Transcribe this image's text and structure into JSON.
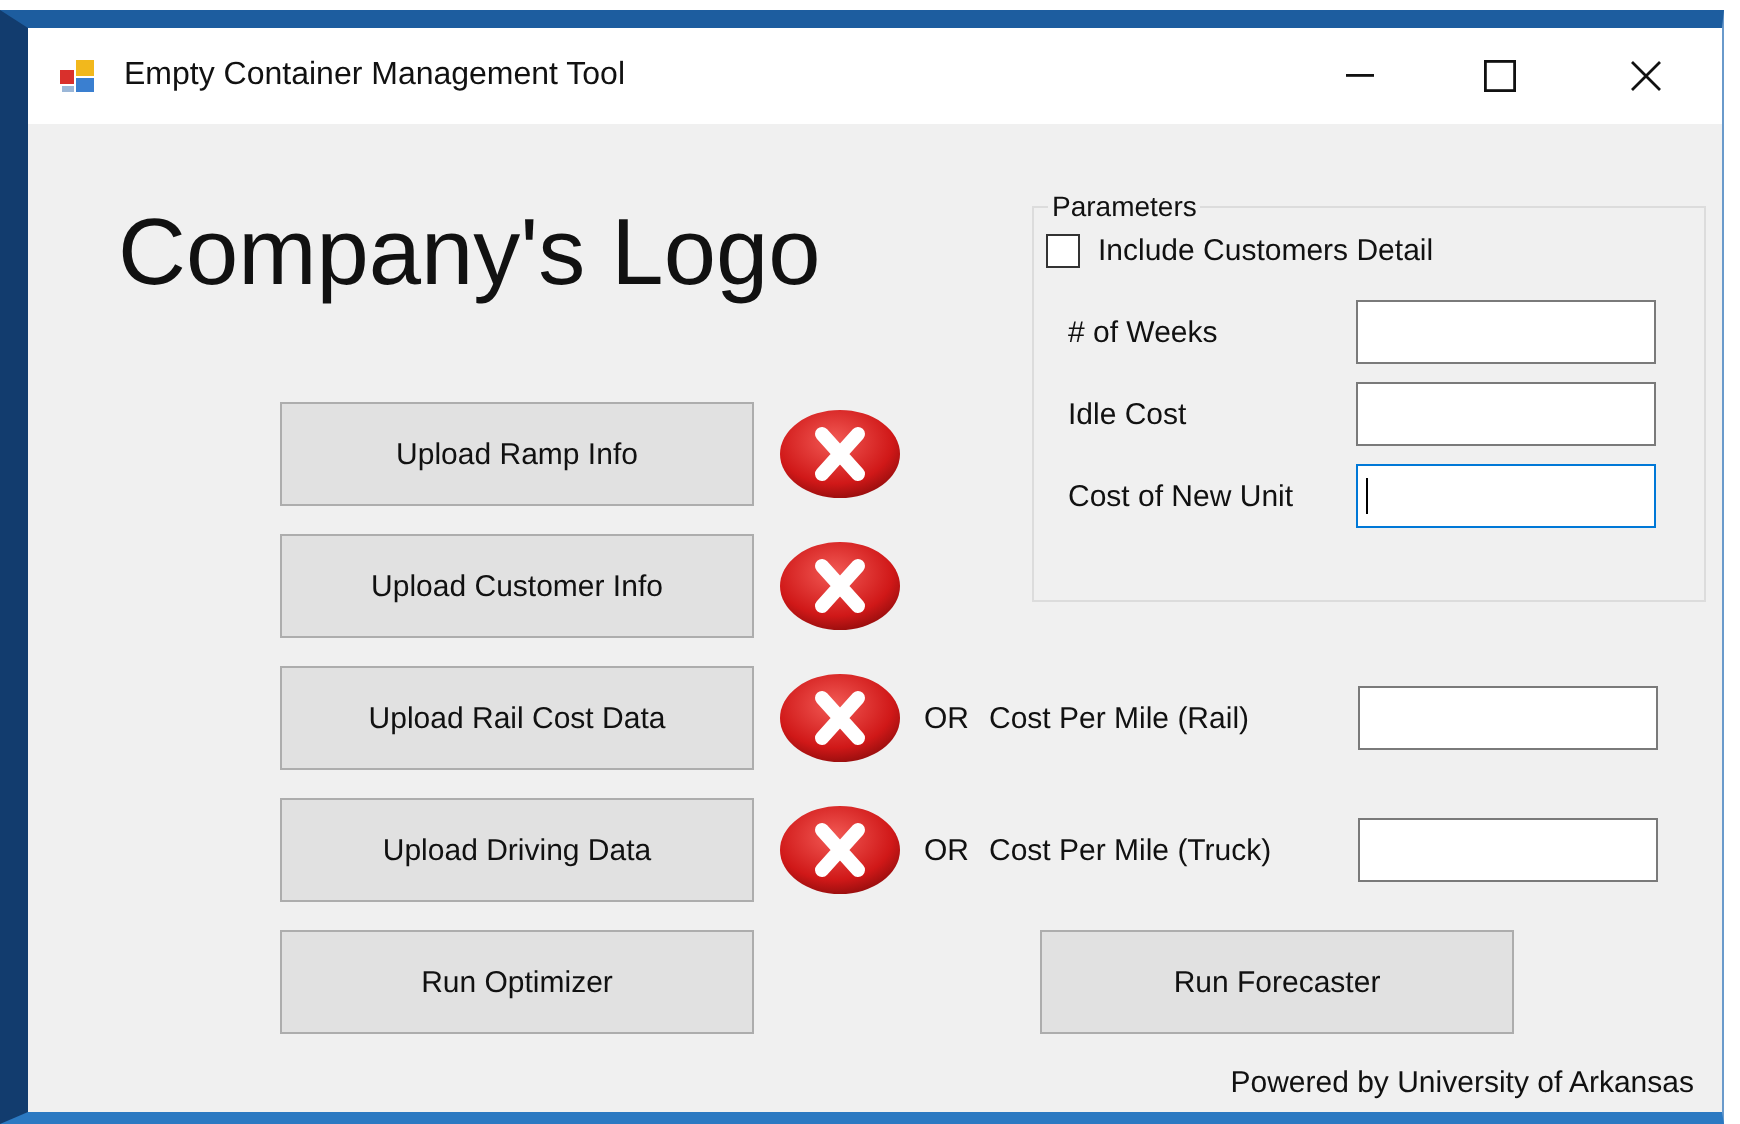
{
  "window": {
    "title": "Empty Container Management Tool"
  },
  "logo_text": "Company's Logo",
  "parameters": {
    "title": "Parameters",
    "checkbox": {
      "label": "Include Customers Detail",
      "checked": false
    },
    "fields": [
      {
        "label": "# of Weeks",
        "focused": false
      },
      {
        "label": "Idle Cost",
        "focused": false
      },
      {
        "label": "Cost of New Unit",
        "focused": true
      }
    ]
  },
  "uploads": [
    {
      "label": "Upload Ramp Info",
      "kind": "error"
    },
    {
      "label": "Upload Customer Info",
      "kind": "error"
    },
    {
      "label": "Upload Rail Cost Data",
      "kind": "error",
      "alt": {
        "prefix": "OR",
        "label": "Cost Per Mile (Rail)"
      }
    },
    {
      "label": "Upload Driving Data",
      "kind": "error",
      "alt": {
        "prefix": "OR",
        "label": "Cost Per Mile (Truck)"
      }
    }
  ],
  "actions": [
    "Run Optimizer",
    "Run Forecaster"
  ],
  "footer": "Powered by University of Arkansas"
}
